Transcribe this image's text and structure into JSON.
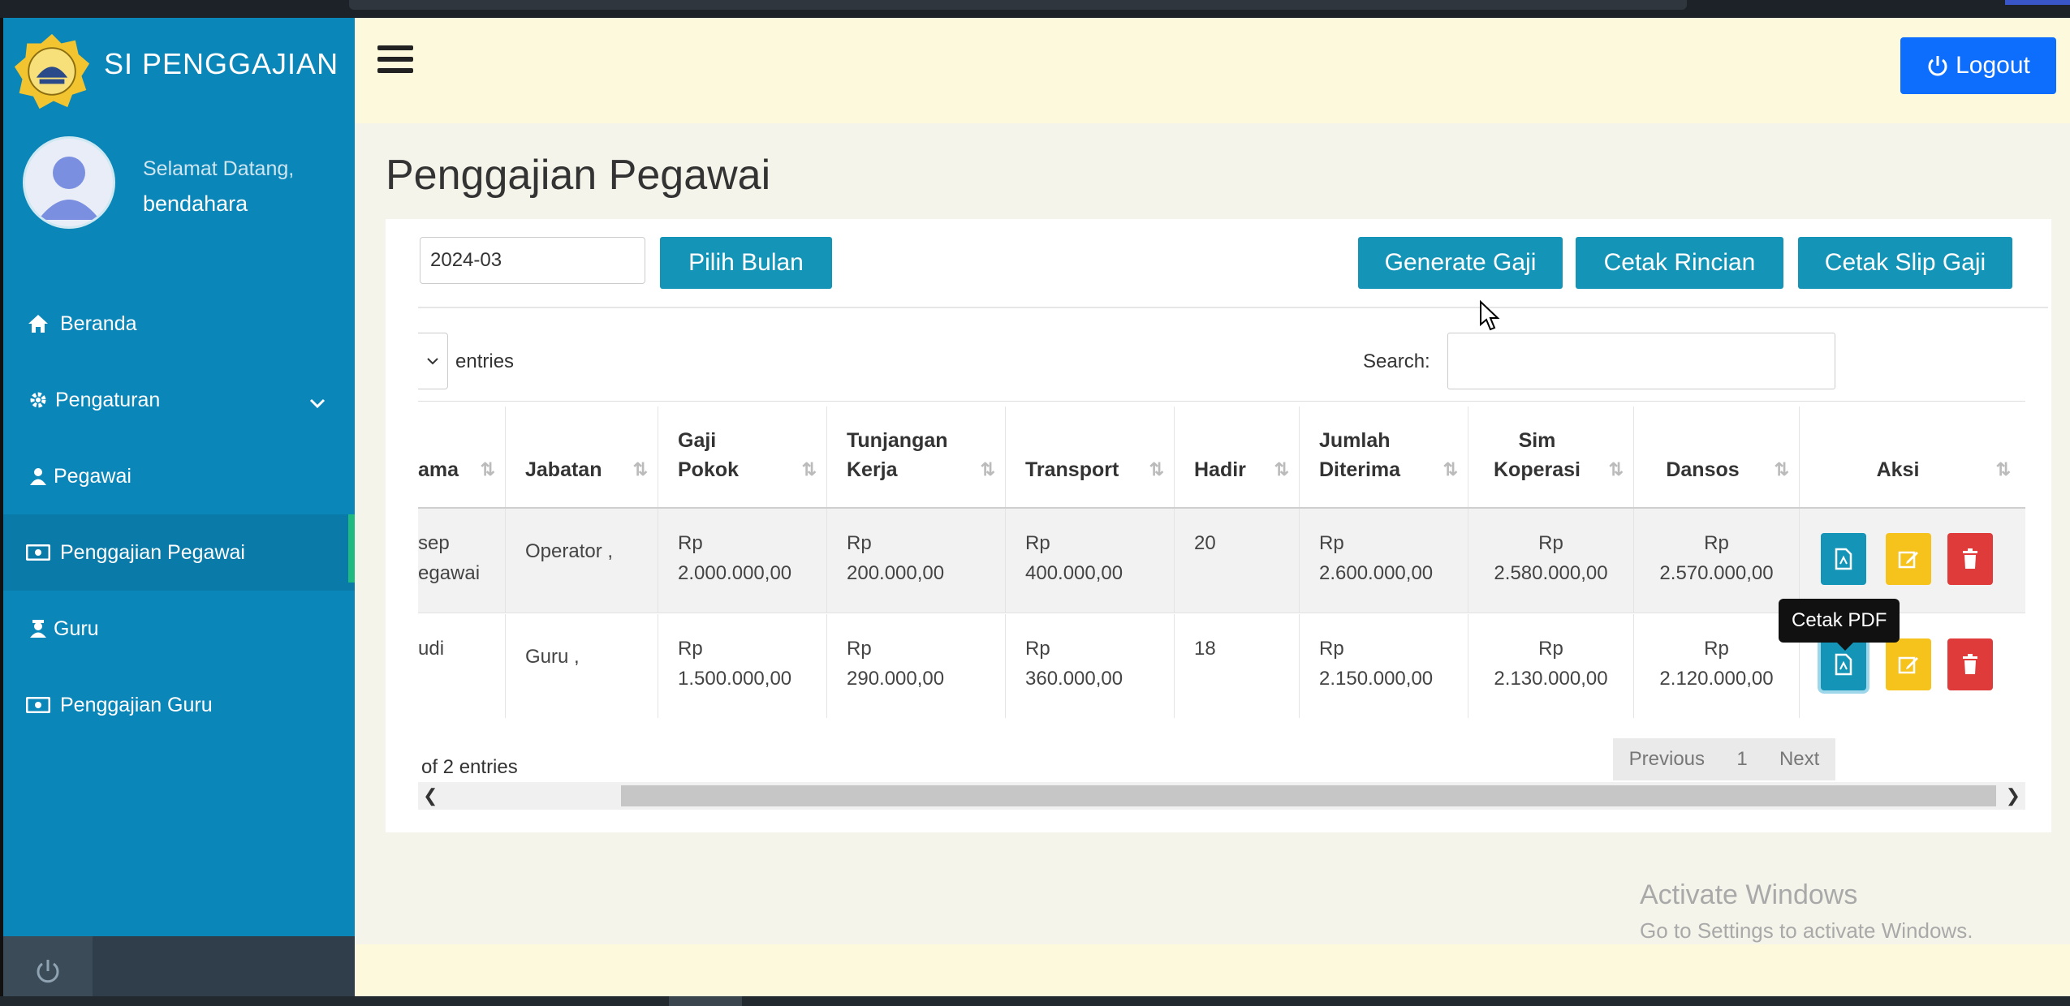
{
  "app": {
    "brand": "SI PENGGAJIAN"
  },
  "user": {
    "welcome": "Selamat Datang,",
    "name": "bendahara"
  },
  "sidebar": {
    "items": [
      {
        "label": "Beranda",
        "icon": "home-icon"
      },
      {
        "label": "Pengaturan",
        "icon": "gear-icon"
      },
      {
        "label": "Pegawai",
        "icon": "user-icon"
      },
      {
        "label": "Penggajian Pegawai",
        "icon": "money-icon"
      },
      {
        "label": "Guru",
        "icon": "teacher-icon"
      },
      {
        "label": "Penggajian Guru",
        "icon": "money-icon"
      }
    ]
  },
  "header": {
    "logout_label": "Logout"
  },
  "page": {
    "title": "Penggajian Pegawai"
  },
  "toolbar": {
    "month_value": "2024-03",
    "pick_label": "Pilih Bulan",
    "generate_label": "Generate Gaji",
    "print_detail_label": "Cetak Rincian",
    "print_slip_label": "Cetak Slip Gaji"
  },
  "table_controls": {
    "entries_label": "entries",
    "search_label": "Search:"
  },
  "table": {
    "headers": [
      [
        "ama"
      ],
      [
        "Jabatan"
      ],
      [
        "Gaji",
        "Pokok"
      ],
      [
        "Tunjangan",
        "Kerja"
      ],
      [
        "Transport"
      ],
      [
        "Hadir"
      ],
      [
        "Jumlah",
        "Diterima"
      ],
      [
        "Sim",
        "Koperasi"
      ],
      [
        "Dansos"
      ],
      [
        "Aksi"
      ]
    ],
    "rows": [
      {
        "nama": [
          "sep",
          "egawai"
        ],
        "jabatan": "Operator ,",
        "gaji_pokok": [
          "Rp",
          "2.000.000,00"
        ],
        "tunjangan": [
          "Rp",
          "200.000,00"
        ],
        "transport": [
          "Rp",
          "400.000,00"
        ],
        "hadir": "20",
        "jumlah": [
          "Rp",
          "2.600.000,00"
        ],
        "koperasi": [
          "Rp",
          "2.580.000,00"
        ],
        "dansos": [
          "Rp",
          "2.570.000,00"
        ]
      },
      {
        "nama": [
          "udi",
          ""
        ],
        "jabatan": "Guru ,",
        "gaji_pokok": [
          "Rp",
          "1.500.000,00"
        ],
        "tunjangan": [
          "Rp",
          "290.000,00"
        ],
        "transport": [
          "Rp",
          "360.000,00"
        ],
        "hadir": "18",
        "jumlah": [
          "Rp",
          "2.150.000,00"
        ],
        "koperasi": [
          "Rp",
          "2.130.000,00"
        ],
        "dansos": [
          "Rp",
          "2.120.000,00"
        ]
      }
    ]
  },
  "tooltip": {
    "text": "Cetak PDF"
  },
  "footer_info": "of 2 entries",
  "pagination": {
    "previous": "Previous",
    "page": "1",
    "next": "Next"
  },
  "watermark": {
    "line1": "Activate Windows",
    "line2": "Go to Settings to activate Windows."
  },
  "colors": {
    "sidebar": "#0b86b8",
    "primary": "#0d6efd",
    "teal": "#1495b8",
    "warning": "#f6c21c",
    "danger": "#e03b3b"
  }
}
